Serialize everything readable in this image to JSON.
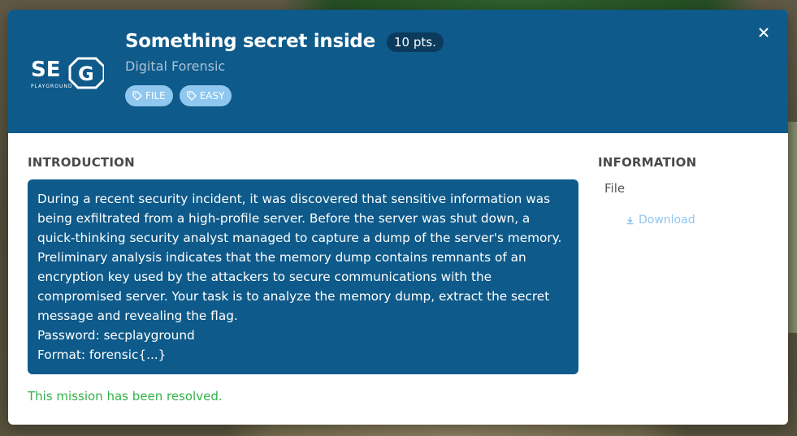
{
  "modal": {
    "logo_text": "SEC PLAYGROUND",
    "title": "Something secret inside",
    "points": "10 pts.",
    "category": "Digital Forensic",
    "tags": [
      {
        "label": "FILE",
        "icon": "tag-icon"
      },
      {
        "label": "EASY",
        "icon": "tag-icon"
      }
    ],
    "close_icon": "close-icon"
  },
  "introduction": {
    "heading": "INTRODUCTION",
    "text": "During a recent security incident, it was discovered that sensitive information was being exfiltrated from a high-profile server. Before the server was shut down, a quick-thinking security analyst managed to capture a dump of the server's memory. Preliminary analysis indicates that the memory dump contains remnants of an encryption key used by the attackers to secure communications with the compromised server. Your task is to analyze the memory dump, extract the secret message and revealing the flag.",
    "password_line": "Password: secplayground",
    "format_line": "Format: forensic{...}"
  },
  "status": {
    "resolved_text": "This mission has been resolved."
  },
  "information": {
    "heading": "INFORMATION",
    "file_label": "File",
    "download_label": "Download",
    "download_icon": "download-icon"
  },
  "colors": {
    "header_bg": "#0e5a8a",
    "tag_bg": "#8fc7ef",
    "points_bg": "#0b3a5c",
    "resolved": "#33b24a",
    "download_link": "#8fc7ef"
  }
}
